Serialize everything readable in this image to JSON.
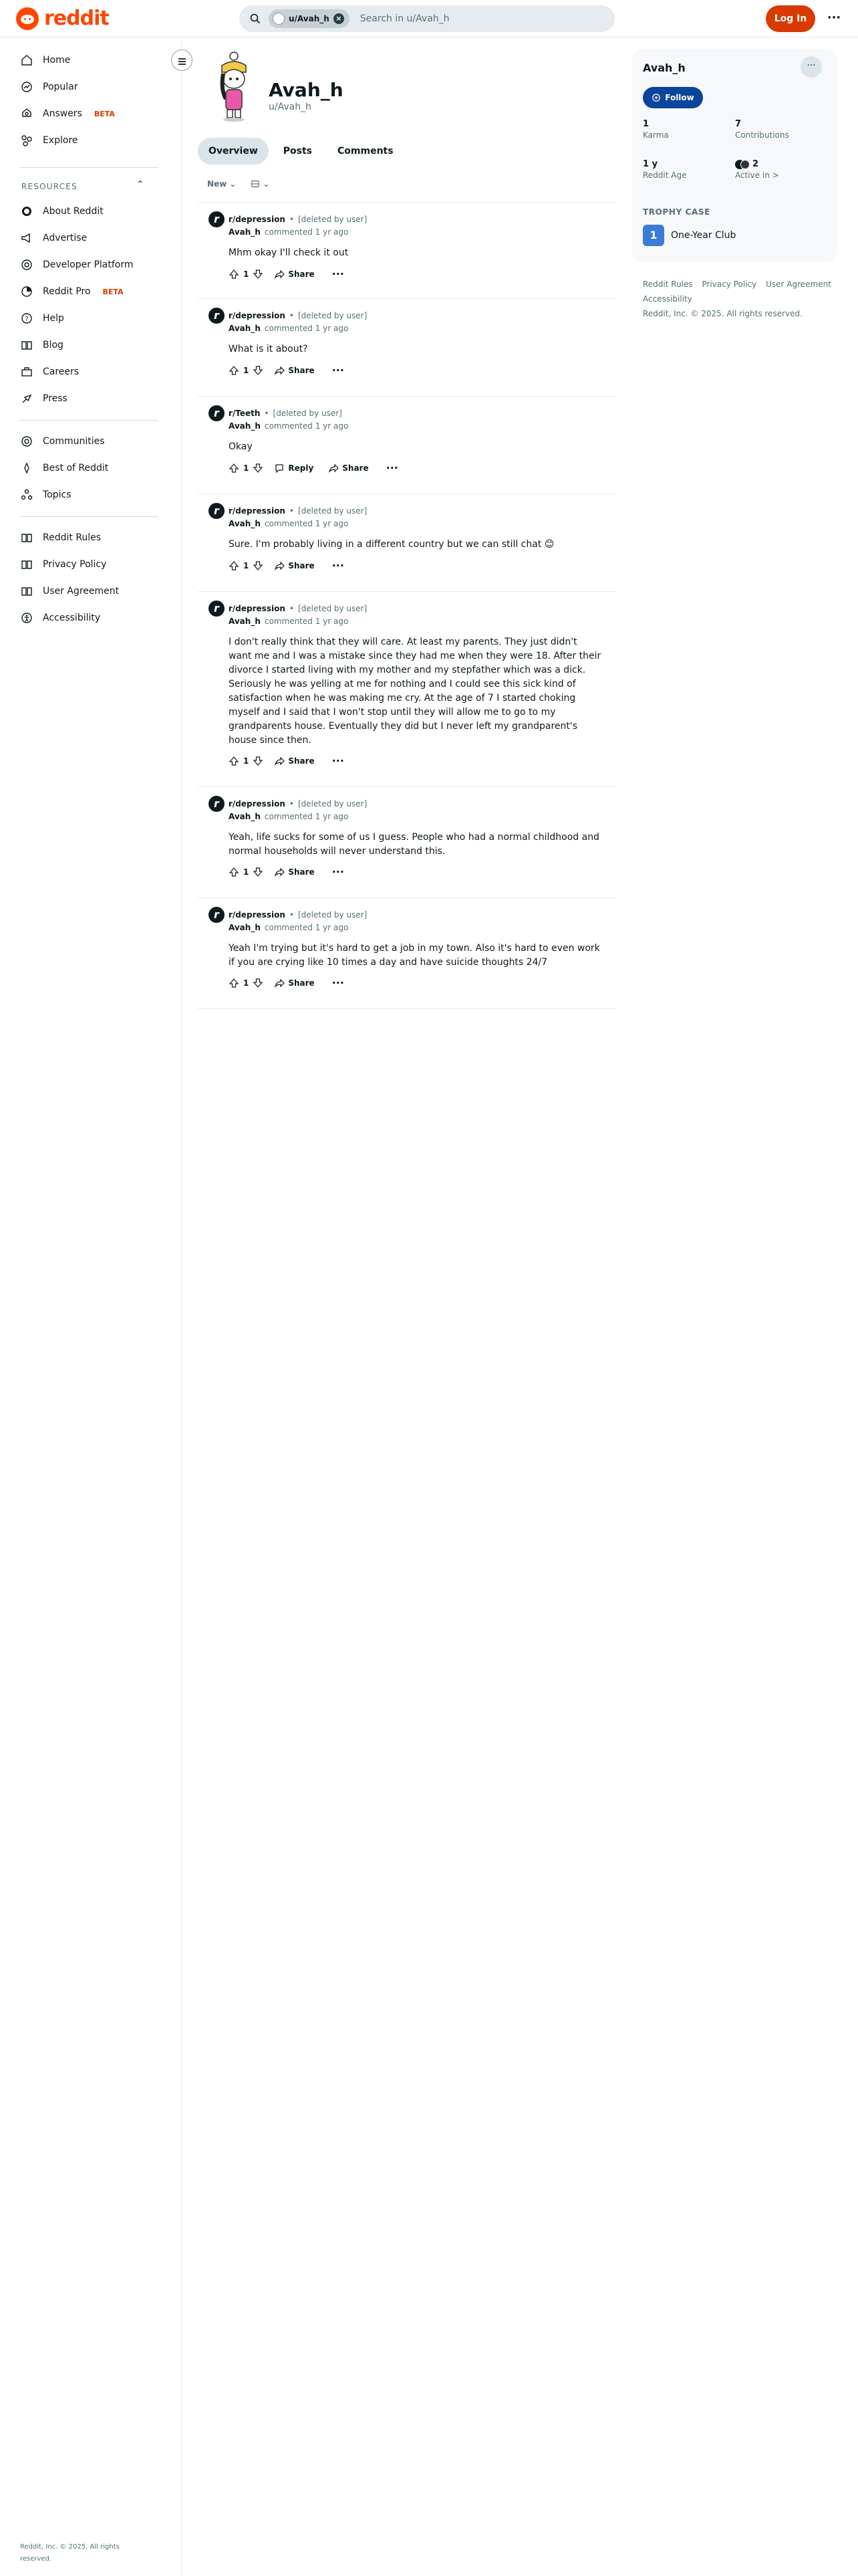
{
  "header": {
    "logo_text": "reddit",
    "search_chip": "u/Avah_h",
    "search_placeholder": "Search in u/Avah_h",
    "login_label": "Log In",
    "more_label": "···"
  },
  "sidebar": {
    "main": [
      {
        "label": "Home",
        "icon": "home-icon"
      },
      {
        "label": "Popular",
        "icon": "popular-icon"
      },
      {
        "label": "Answers",
        "badge": "BETA",
        "icon": "answers-icon"
      },
      {
        "label": "Explore",
        "icon": "explore-icon"
      }
    ],
    "resources_label": "RESOURCES",
    "resources": [
      {
        "label": "About Reddit",
        "icon": "about-icon"
      },
      {
        "label": "Advertise",
        "icon": "advertise-icon"
      },
      {
        "label": "Developer Platform",
        "icon": "developer-icon"
      },
      {
        "label": "Reddit Pro",
        "badge": "BETA",
        "icon": "pro-icon"
      },
      {
        "label": "Help",
        "icon": "help-icon"
      },
      {
        "label": "Blog",
        "icon": "blog-icon"
      },
      {
        "label": "Careers",
        "icon": "careers-icon"
      },
      {
        "label": "Press",
        "icon": "press-icon"
      }
    ],
    "communities": [
      {
        "label": "Communities",
        "icon": "communities-icon"
      },
      {
        "label": "Best of Reddit",
        "icon": "best-icon"
      },
      {
        "label": "Topics",
        "icon": "topics-icon"
      }
    ],
    "policies": [
      {
        "label": "Reddit Rules",
        "icon": "rules-icon"
      },
      {
        "label": "Privacy Policy",
        "icon": "privacy-icon"
      },
      {
        "label": "User Agreement",
        "icon": "agreement-icon"
      },
      {
        "label": "Accessibility",
        "icon": "accessibility-icon"
      }
    ],
    "footer": "Reddit, Inc. © 2025. All rights reserved."
  },
  "profile": {
    "name": "Avah_h",
    "username": "u/Avah_h",
    "tabs": [
      "Overview",
      "Posts",
      "Comments"
    ],
    "active_tab": "Overview",
    "sort_label": "New"
  },
  "comments": [
    {
      "subreddit": "r/depression",
      "op": "[deleted by user]",
      "author": "Avah_h",
      "time": "commented 1 yr ago",
      "body": "Mhm okay I'll check it out",
      "votes": "1",
      "reply": "",
      "share": "Share"
    },
    {
      "subreddit": "r/depression",
      "op": "[deleted by user]",
      "author": "Avah_h",
      "time": "commented 1 yr ago",
      "body": "What is it about?",
      "votes": "1",
      "reply": "",
      "share": "Share"
    },
    {
      "subreddit": "r/Teeth",
      "op": "[deleted by user]",
      "author": "Avah_h",
      "time": "commented 1 yr ago",
      "body": "Okay",
      "votes": "1",
      "reply": "Reply",
      "share": "Share"
    },
    {
      "subreddit": "r/depression",
      "op": "[deleted by user]",
      "author": "Avah_h",
      "time": "commented 1 yr ago",
      "body": "Sure. I'm probably living in a different country but we can still chat 😊",
      "votes": "1",
      "reply": "",
      "share": "Share"
    },
    {
      "subreddit": "r/depression",
      "op": "[deleted by user]",
      "author": "Avah_h",
      "time": "commented 1 yr ago",
      "body": "I don't really think that they will care. At least my parents. They just didn't want me and I was a mistake since they had me when they were 18. After their divorce I started living with my mother and my stepfather which was a dick. Seriously he was yelling at me for nothing and I could see this sick kind of satisfaction when he was making me cry. At the age of 7 I started choking myself and I said that I won't stop until they will allow me to go to my grandparents house. Eventually they did but I never left my grandparent's house since then.",
      "votes": "1",
      "reply": "",
      "share": "Share"
    },
    {
      "subreddit": "r/depression",
      "op": "[deleted by user]",
      "author": "Avah_h",
      "time": "commented 1 yr ago",
      "body": "Yeah, life sucks for some of us I guess. People who had a normal childhood and normal households will never understand this.",
      "votes": "1",
      "reply": "",
      "share": "Share"
    },
    {
      "subreddit": "r/depression",
      "op": "[deleted by user]",
      "author": "Avah_h",
      "time": "commented 1 yr ago",
      "body": "Yeah I'm trying but it's hard to get a job in my town. Also it's hard to even work if you are crying like 10 times a day and have suicide thoughts 24/7",
      "votes": "1",
      "reply": "",
      "share": "Share"
    }
  ],
  "right_panel": {
    "name": "Avah_h",
    "follow_label": "Follow",
    "karma": "1",
    "karma_label": "Karma",
    "contributions": "7",
    "contributions_label": "Contributions",
    "age": "1 y",
    "age_label": "Reddit Age",
    "active_in": "2",
    "active_in_label": "Active in >",
    "trophy_label": "TROPHY CASE",
    "trophy": "One-Year Club"
  },
  "right_links": {
    "rules": "Reddit Rules",
    "privacy": "Privacy Policy",
    "agreement": "User Agreement",
    "accessibility": "Accessibility",
    "copyright": "Reddit, Inc. © 2025. All rights reserved."
  },
  "colors": {
    "brand": "#ff4500",
    "login": "#d93a00",
    "follow": "#0a449b"
  }
}
